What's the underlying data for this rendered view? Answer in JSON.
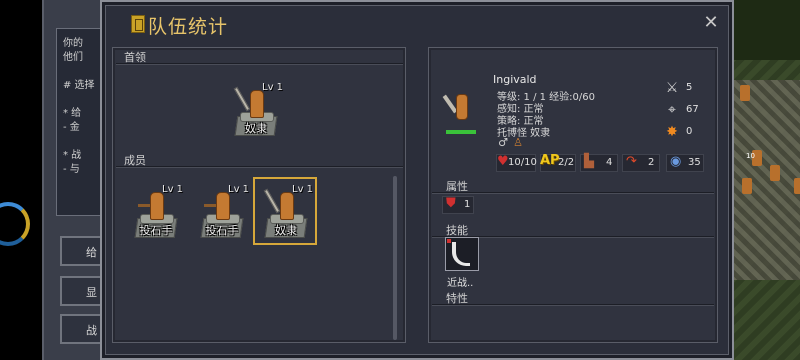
{
  "window": {
    "title": "队伍统计",
    "close_glyph": "✕"
  },
  "background": {
    "textbox_lines": [
      "你的",
      "他们",
      "",
      "# 选择",
      "",
      "* 给",
      "- 金",
      "",
      "* 战",
      "- 与"
    ],
    "side_buttons": [
      "给",
      "显",
      "战"
    ],
    "map_unit_label": "10"
  },
  "leader_section": {
    "label": "首领",
    "unit": {
      "name": "奴隶",
      "level": "Lv 1",
      "class": "slave"
    }
  },
  "members_section": {
    "label": "成员",
    "units": [
      {
        "name": "投石手",
        "level": "Lv 1",
        "class": "slinger",
        "selected": false
      },
      {
        "name": "投石手",
        "level": "Lv 1",
        "class": "slinger",
        "selected": false
      },
      {
        "name": "奴隶",
        "level": "Lv 1",
        "class": "slave",
        "selected": true
      }
    ]
  },
  "detail": {
    "name": "Ingivald",
    "level_line": "等级: 1 / 1  经验:0/60",
    "perception": "感知: 正常",
    "strategy": "策略: 正常",
    "trait_line": "托博怪 奴隶",
    "gender_icon": "male-icon",
    "role_icon": "figure-icon",
    "stats_row": {
      "hp": "10/10",
      "ap_label": "AP",
      "ap": "2/2",
      "move": "4",
      "range": "2",
      "resist": "35"
    },
    "side_stats": {
      "attack": "5",
      "accuracy": "67",
      "damage": "0"
    },
    "attributes_label": "属性",
    "attributes": [
      {
        "icon": "shield-icon",
        "value": "1"
      }
    ],
    "skills_label": "技能",
    "skills": [
      {
        "icon": "claw-icon",
        "name": "近战.."
      }
    ],
    "traits_label": "特性"
  },
  "colors": {
    "title": "#e7c46a",
    "selection_border": "#d6a83a",
    "ap": "#f0c81c",
    "hp_bar": "#3ac23a"
  }
}
